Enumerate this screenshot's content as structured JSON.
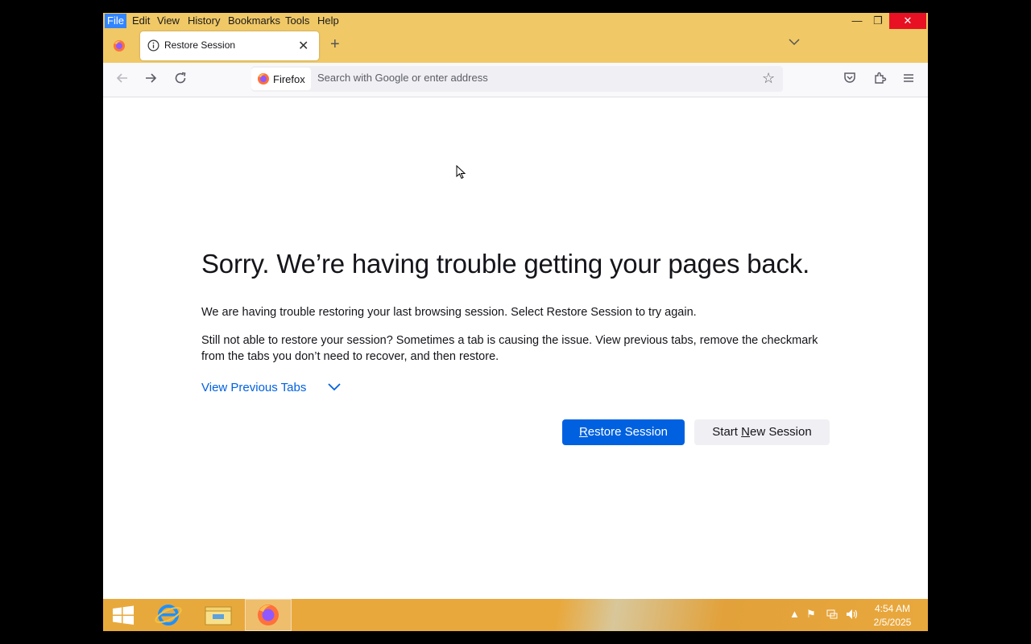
{
  "menubar": {
    "items": [
      "File",
      "Edit",
      "View",
      "History",
      "Bookmarks",
      "Tools",
      "Help"
    ],
    "active": "File"
  },
  "window_controls": {
    "minimize": "—",
    "restore": "❐",
    "close": "✕"
  },
  "tab": {
    "title": "Restore Session"
  },
  "navbar": {
    "identity_label": "Firefox",
    "url_placeholder": "Search with Google or enter address"
  },
  "page": {
    "title": "Sorry. We’re having trouble getting your pages back.",
    "para1": "We are having trouble restoring your last browsing session. Select Restore Session to try again.",
    "para2": "Still not able to restore your session? Sometimes a tab is causing the issue. View previous tabs, remove the checkmark from the tabs you don’t need to recover, and then restore.",
    "view_previous_tabs": "View Previous Tabs",
    "restore_button": {
      "before": "",
      "accel": "R",
      "after": "estore Session"
    },
    "new_session_button": {
      "before": "Start ",
      "accel": "N",
      "after": "ew Session"
    }
  },
  "taskbar": {
    "clock_time": "4:54 AM",
    "clock_date": "2/5/2025"
  },
  "colors": {
    "title_bar": "#f0c866",
    "accent_blue": "#0061e0",
    "close_red": "#e81123"
  }
}
